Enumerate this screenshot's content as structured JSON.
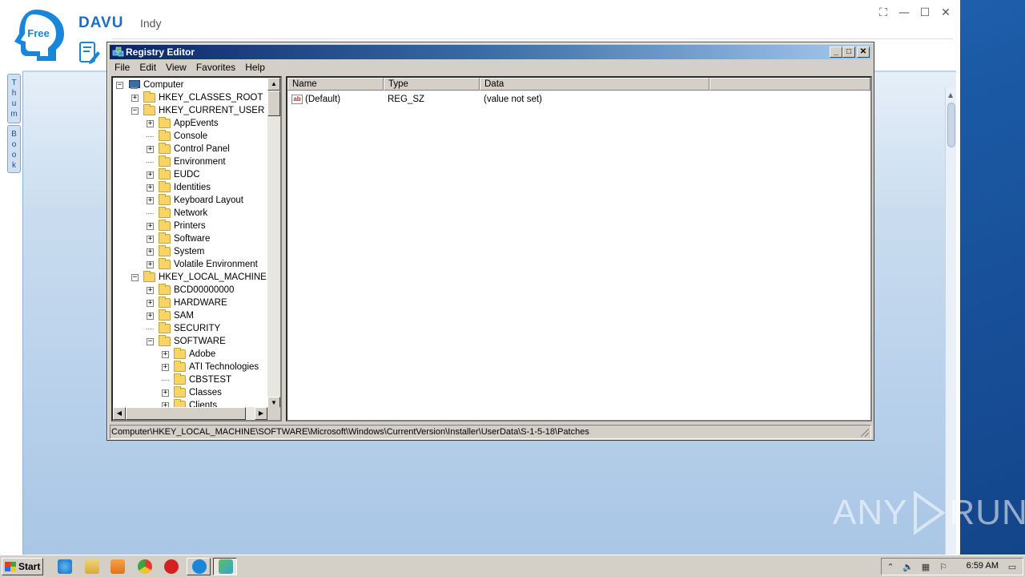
{
  "davu": {
    "logo_text": "Free",
    "title": "DAVU",
    "subtitle": "Indy",
    "side_tabs": [
      [
        "T",
        "h",
        "u",
        "m"
      ],
      [
        "B",
        "o",
        "o",
        "k"
      ]
    ]
  },
  "regedit": {
    "title": "Registry Editor",
    "menu": [
      "File",
      "Edit",
      "View",
      "Favorites",
      "Help"
    ],
    "tree": [
      {
        "label": "Computer",
        "level": 0,
        "icon": "computer-icon",
        "expander": "minus"
      },
      {
        "label": "HKEY_CLASSES_ROOT",
        "level": 1,
        "expander": "plus"
      },
      {
        "label": "HKEY_CURRENT_USER",
        "level": 1,
        "expander": "minus"
      },
      {
        "label": "AppEvents",
        "level": 2,
        "expander": "plus"
      },
      {
        "label": "Console",
        "level": 2,
        "expander": "none"
      },
      {
        "label": "Control Panel",
        "level": 2,
        "expander": "plus"
      },
      {
        "label": "Environment",
        "level": 2,
        "expander": "none"
      },
      {
        "label": "EUDC",
        "level": 2,
        "expander": "plus"
      },
      {
        "label": "Identities",
        "level": 2,
        "expander": "plus"
      },
      {
        "label": "Keyboard Layout",
        "level": 2,
        "expander": "plus"
      },
      {
        "label": "Network",
        "level": 2,
        "expander": "none"
      },
      {
        "label": "Printers",
        "level": 2,
        "expander": "plus"
      },
      {
        "label": "Software",
        "level": 2,
        "expander": "plus"
      },
      {
        "label": "System",
        "level": 2,
        "expander": "plus"
      },
      {
        "label": "Volatile Environment",
        "level": 2,
        "expander": "plus"
      },
      {
        "label": "HKEY_LOCAL_MACHINE",
        "level": 1,
        "expander": "minus"
      },
      {
        "label": "BCD00000000",
        "level": 2,
        "expander": "plus"
      },
      {
        "label": "HARDWARE",
        "level": 2,
        "expander": "plus"
      },
      {
        "label": "SAM",
        "level": 2,
        "expander": "plus"
      },
      {
        "label": "SECURITY",
        "level": 2,
        "expander": "none"
      },
      {
        "label": "SOFTWARE",
        "level": 2,
        "expander": "minus"
      },
      {
        "label": "Adobe",
        "level": 3,
        "expander": "plus"
      },
      {
        "label": "ATI Technologies",
        "level": 3,
        "expander": "plus"
      },
      {
        "label": "CBSTEST",
        "level": 3,
        "expander": "none"
      },
      {
        "label": "Classes",
        "level": 3,
        "expander": "plus"
      },
      {
        "label": "Clients",
        "level": 3,
        "expander": "plus"
      }
    ],
    "columns": [
      "Name",
      "Type",
      "Data"
    ],
    "values": [
      {
        "name": "(Default)",
        "type": "REG_SZ",
        "data": "(value not set)"
      }
    ],
    "status_path": "Computer\\HKEY_LOCAL_MACHINE\\SOFTWARE\\Microsoft\\Windows\\CurrentVersion\\Installer\\UserData\\S-1-5-18\\Patches"
  },
  "watermark": {
    "left": "ANY",
    "right": "RUN"
  },
  "taskbar": {
    "start_label": "Start",
    "clock": "6:59 AM"
  }
}
